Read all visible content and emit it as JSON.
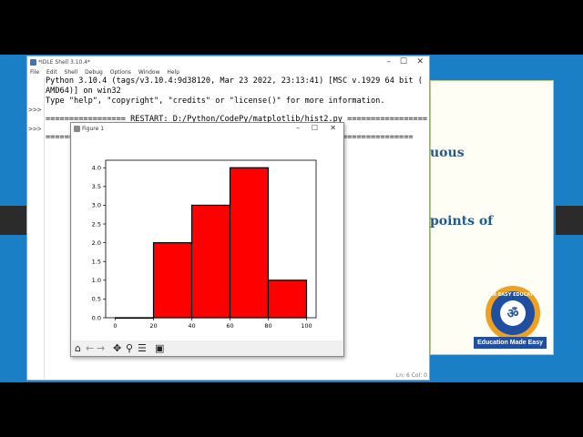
{
  "slide": {
    "text_fragments": [
      "uous",
      "points of"
    ]
  },
  "logo": {
    "arc_top": "ESAR EASY EDUCATION",
    "banner": "Education Made Easy"
  },
  "idle": {
    "title": "*IDLE Shell 3.10.4*",
    "window_controls": {
      "minimize": "–",
      "maximize": "☐",
      "close": "✕"
    },
    "menu": [
      "File",
      "Edit",
      "Shell",
      "Debug",
      "Options",
      "Window",
      "Help"
    ],
    "prompts": [
      ">>>",
      ">>>"
    ],
    "lines": [
      "Python 3.10.4 (tags/v3.10.4:9d38120, Mar 23 2022, 23:13:41) [MSC v.1929 64 bit (",
      "AMD64)] on win32",
      "Type \"help\", \"copyright\", \"credits\" or \"license()\" for more information.",
      "================= RESTART: D:/Python/CodePy/matplotlib/hist2.py =================",
      "=============================================================================="
    ],
    "status": "Ln: 6 Col: 0"
  },
  "figure": {
    "title": "Figure 1",
    "window_controls": {
      "minimize": "–",
      "maximize": "☐",
      "close": "✕"
    },
    "toolbar": {
      "home": "⌂",
      "back": "←",
      "forward": "→",
      "pan": "✥",
      "zoom": "⚲",
      "configure": "☰",
      "save": "▣"
    }
  },
  "chart_data": {
    "type": "bar",
    "title": "",
    "xlabel": "",
    "ylabel": "",
    "bin_edges": [
      0,
      20,
      40,
      60,
      80,
      100
    ],
    "values": [
      0,
      2,
      3,
      4,
      1
    ],
    "xlim": [
      -5,
      105
    ],
    "ylim": [
      0,
      4.2
    ],
    "xticks": [
      "0",
      "20",
      "40",
      "60",
      "80",
      "100"
    ],
    "yticks": [
      "0.0",
      "0.5",
      "1.0",
      "1.5",
      "2.0",
      "2.5",
      "3.0",
      "3.5",
      "4.0"
    ],
    "bar_color": "#ff0000",
    "edge_color": "#000000",
    "grid": false
  }
}
